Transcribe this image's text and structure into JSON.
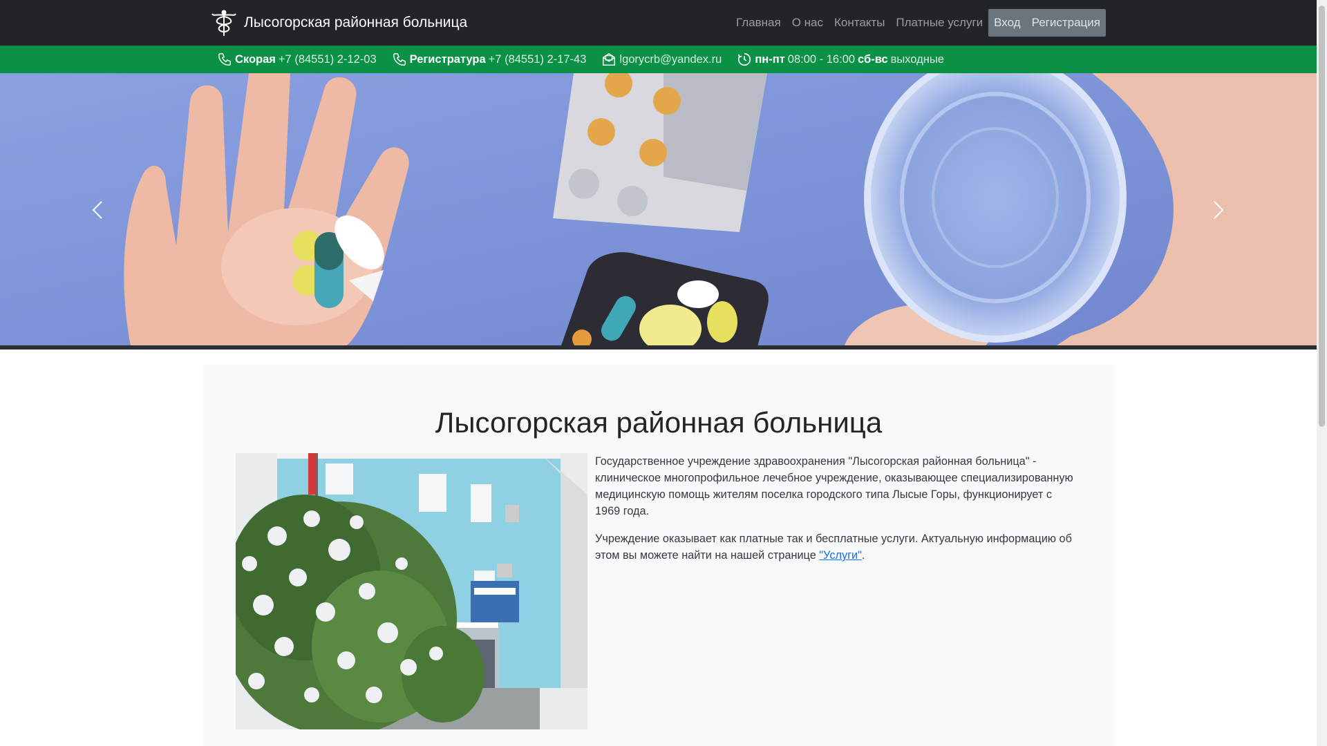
{
  "nav": {
    "brand": "Лысогорская районная больница",
    "links": [
      "Главная",
      "О нас",
      "Контакты",
      "Платные услуги"
    ],
    "login": "Вход",
    "register": "Регистрация"
  },
  "info": {
    "ambulance_label": "Скорая",
    "ambulance_phone": "+7 (84551) 2-12-03",
    "registry_label": "Регистратура",
    "registry_phone": "+7 (84551) 2-17-43",
    "email": "lgorycrb@yandex.ru",
    "weekdays_label": "пн-пт",
    "weekdays_hours": "08:00 - 16:00",
    "weekend_label": "сб-вс",
    "weekend_text": "выходные"
  },
  "content": {
    "title": "Лысогорская районная больница",
    "p1": "Государственное учреждение здравоохранения \"Лысогорская районная больница\" - клиническое многопрофильное лечебное учреждение, оказывающее специализированную медицинскую помощь жителям поселка городского типа Лысые Горы, функционирует с 1969 года.",
    "p2_start": "Учреждение оказывает как платные так и бесплатные услуги. Актуальную информацию об этом вы можете найти на нашей странице ",
    "p2_link": "\"Услуги\"",
    "p2_end": "."
  },
  "colors": {
    "navbar": "#212529",
    "infobar": "#0b9146",
    "content_bg": "#f8f9fa",
    "link": "#0d6efd"
  },
  "icons": [
    "caduceus-icon",
    "phone-icon",
    "mail-icon",
    "clock-icon",
    "chevron-left-icon",
    "chevron-right-icon"
  ]
}
